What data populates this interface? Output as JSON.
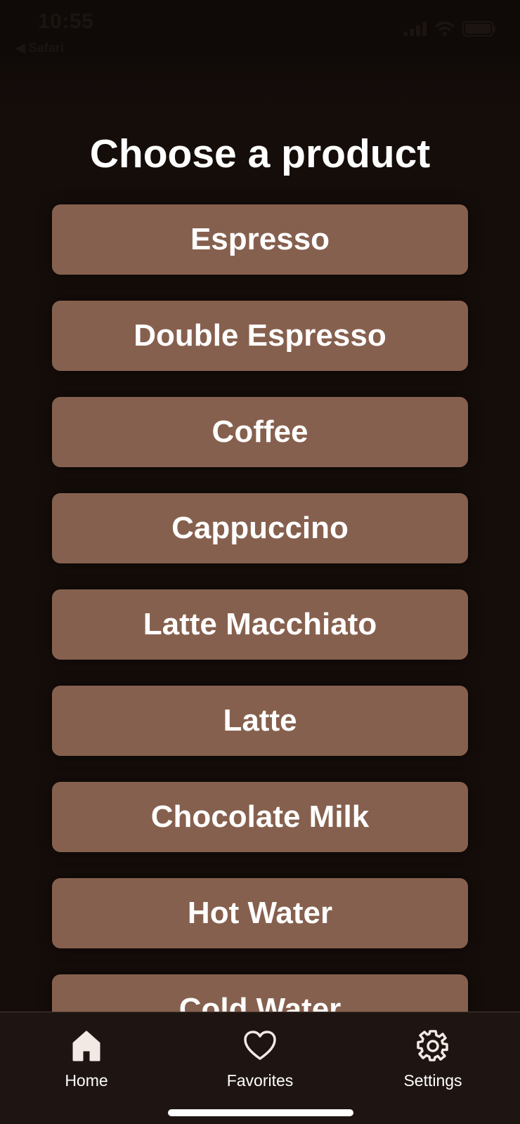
{
  "status_bar": {
    "time": "10:55",
    "back_label": "◀ Safari",
    "icons": [
      "cellular-signal-icon",
      "wifi-icon",
      "battery-icon"
    ]
  },
  "main": {
    "title": "Choose a product",
    "products": [
      "Espresso",
      "Double Espresso",
      "Coffee",
      "Cappuccino",
      "Latte Macchiato",
      "Latte",
      "Chocolate Milk",
      "Hot Water",
      "Cold Water"
    ]
  },
  "tab_bar": {
    "tabs": [
      {
        "label": "Home",
        "icon": "home-icon"
      },
      {
        "label": "Favorites",
        "icon": "heart-icon"
      },
      {
        "label": "Settings",
        "icon": "gear-icon"
      }
    ]
  },
  "colors": {
    "background": "#150d0a",
    "button": "#86604e",
    "tab_bar": "#1e1512",
    "text": "#ffffff"
  }
}
